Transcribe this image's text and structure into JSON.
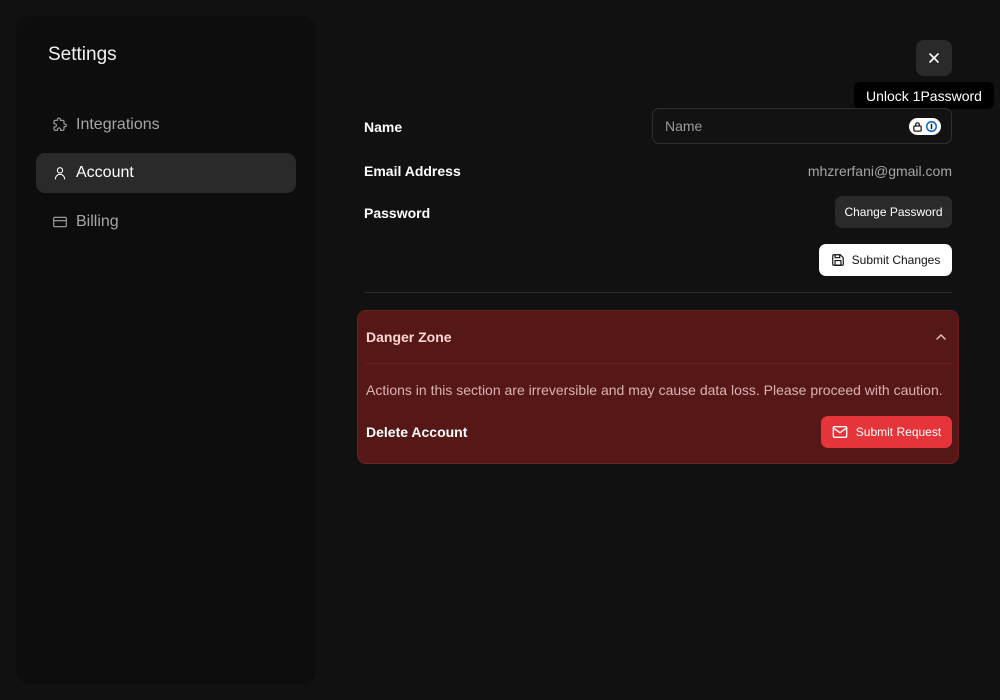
{
  "sidebar": {
    "title": "Settings",
    "items": [
      {
        "label": "Integrations",
        "icon": "puzzle-icon",
        "active": false
      },
      {
        "label": "Account",
        "icon": "user-icon",
        "active": true
      },
      {
        "label": "Billing",
        "icon": "credit-card-icon",
        "active": false
      }
    ]
  },
  "header": {
    "close_icon": "close-icon",
    "tooltip": "Unlock 1Password"
  },
  "form": {
    "name_label": "Name",
    "name_value": "",
    "name_placeholder": "Name",
    "email_label": "Email Address",
    "email_value": "mhzrerfani@gmail.com",
    "password_label": "Password",
    "change_password_label": "Change Password",
    "submit_changes_label": "Submit Changes"
  },
  "danger_zone": {
    "title": "Danger Zone",
    "description": "Actions in this section are irreversible and may cause data loss. Please proceed with caution.",
    "delete_label": "Delete Account",
    "submit_request_label": "Submit Request"
  },
  "colors": {
    "background": "#111111",
    "sidebar": "#0d0d0d",
    "active_item": "#2a2a2a",
    "danger_bg": "#561717",
    "danger_button": "#e5353a"
  }
}
